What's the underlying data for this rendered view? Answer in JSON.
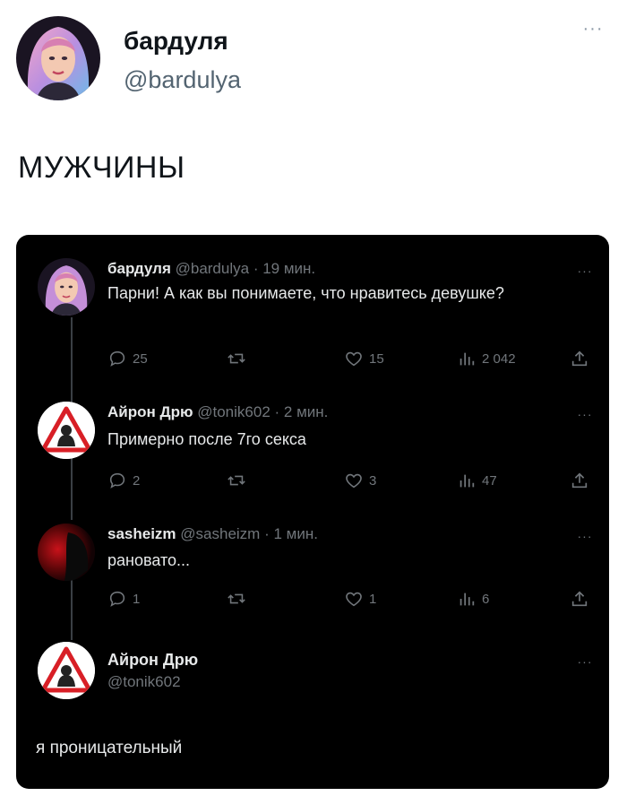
{
  "outer": {
    "author_name": "бардуля",
    "author_handle": "@bardulya",
    "more_glyph": "···",
    "text": "МУЖЧИНЫ"
  },
  "thread": {
    "posts": [
      {
        "name": "бардуля",
        "handle": "@bardulya",
        "time": "19 мин.",
        "text": "Парни! А как вы понимаете, что нравитесь девушке?",
        "replies": "25",
        "reposts": "",
        "likes": "15",
        "views": "2 042"
      },
      {
        "name": "Айрон Дрю",
        "handle": "@tonik602",
        "time": "2 мин.",
        "text": "Примерно после 7го секса",
        "replies": "2",
        "reposts": "",
        "likes": "3",
        "views": "47"
      },
      {
        "name": "sasheizm",
        "handle": "@sasheizm",
        "time": "1 мин.",
        "text": "рановато...",
        "replies": "1",
        "reposts": "",
        "likes": "1",
        "views": "6"
      }
    ],
    "final": {
      "name": "Айрон Дрю",
      "handle": "@tonik602",
      "text": "я проницательный"
    },
    "more_glyph": "···",
    "separator": "·"
  },
  "icons": [
    "reply-icon",
    "repost-icon",
    "like-icon",
    "views-icon",
    "share-icon",
    "more-icon"
  ],
  "colors": {
    "card_bg": "#000000",
    "text_primary": "#e7e9ea",
    "text_secondary": "#71767b",
    "outer_handle": "#536471"
  }
}
